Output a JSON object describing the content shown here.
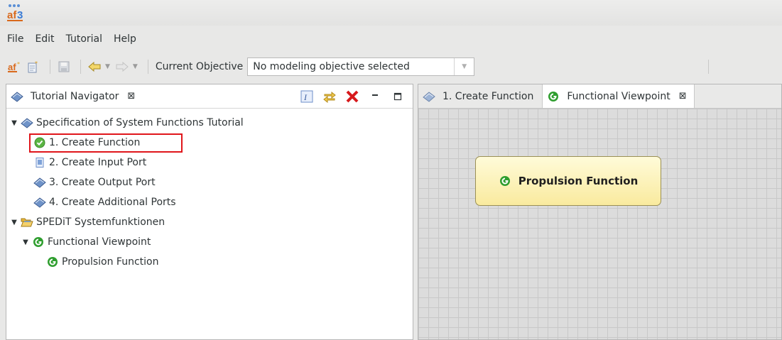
{
  "app": {
    "logo_icon": "af3-logo"
  },
  "menu": {
    "items": [
      "File",
      "Edit",
      "Tutorial",
      "Help"
    ]
  },
  "toolbar": {
    "objective_label": "Current Objective",
    "objective_value": "No modeling objective selected"
  },
  "navigator": {
    "title": "Tutorial Navigator",
    "close_glyph": "⊠",
    "tree": {
      "tutorial": "Specification of System Functions Tutorial",
      "steps": [
        "1. Create Function",
        "2. Create Input Port",
        "3. Create Output Port",
        "4. Create Additional Ports"
      ],
      "project": "SPEDiT Systemfunktionen",
      "viewpoint": "Functional Viewpoint",
      "function": "Propulsion Function"
    }
  },
  "editor": {
    "tabs": [
      {
        "label": "1. Create Function",
        "active": false
      },
      {
        "label": "Functional Viewpoint",
        "active": true,
        "close_glyph": "⊠"
      }
    ],
    "diagram": {
      "function_label": "Propulsion Function"
    }
  },
  "colors": {
    "highlight_box": "#e0161b",
    "function_green": "#2f9e2f",
    "function_fill": "#fbefab"
  }
}
